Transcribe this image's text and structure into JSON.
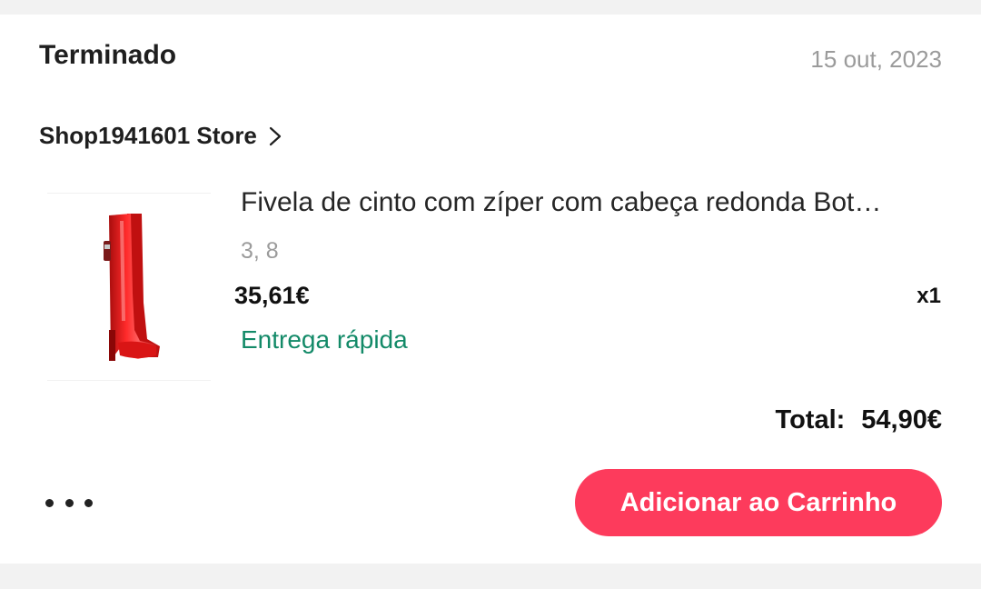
{
  "order": {
    "status": "Terminado",
    "date": "15 out, 2023"
  },
  "store": {
    "name": "Shop1941601 Store",
    "chevron_icon": "chevron-right-icon"
  },
  "product": {
    "image_icon": "red-knee-high-boots",
    "title": "Fivela de cinto com zíper com cabeça redonda Bot…",
    "variant": "3, 8",
    "price": "35,61€",
    "quantity": "x1",
    "delivery": "Entrega rápida"
  },
  "summary": {
    "total_label": "Total:",
    "total_value": "54,90€"
  },
  "actions": {
    "more_icon": "more-horizontal-icon",
    "add_to_cart_label": "Adicionar ao Carrinho"
  },
  "colors": {
    "accent": "#fd3b5c",
    "delivery_green": "#138a68",
    "muted_text": "#9b9b9b"
  }
}
